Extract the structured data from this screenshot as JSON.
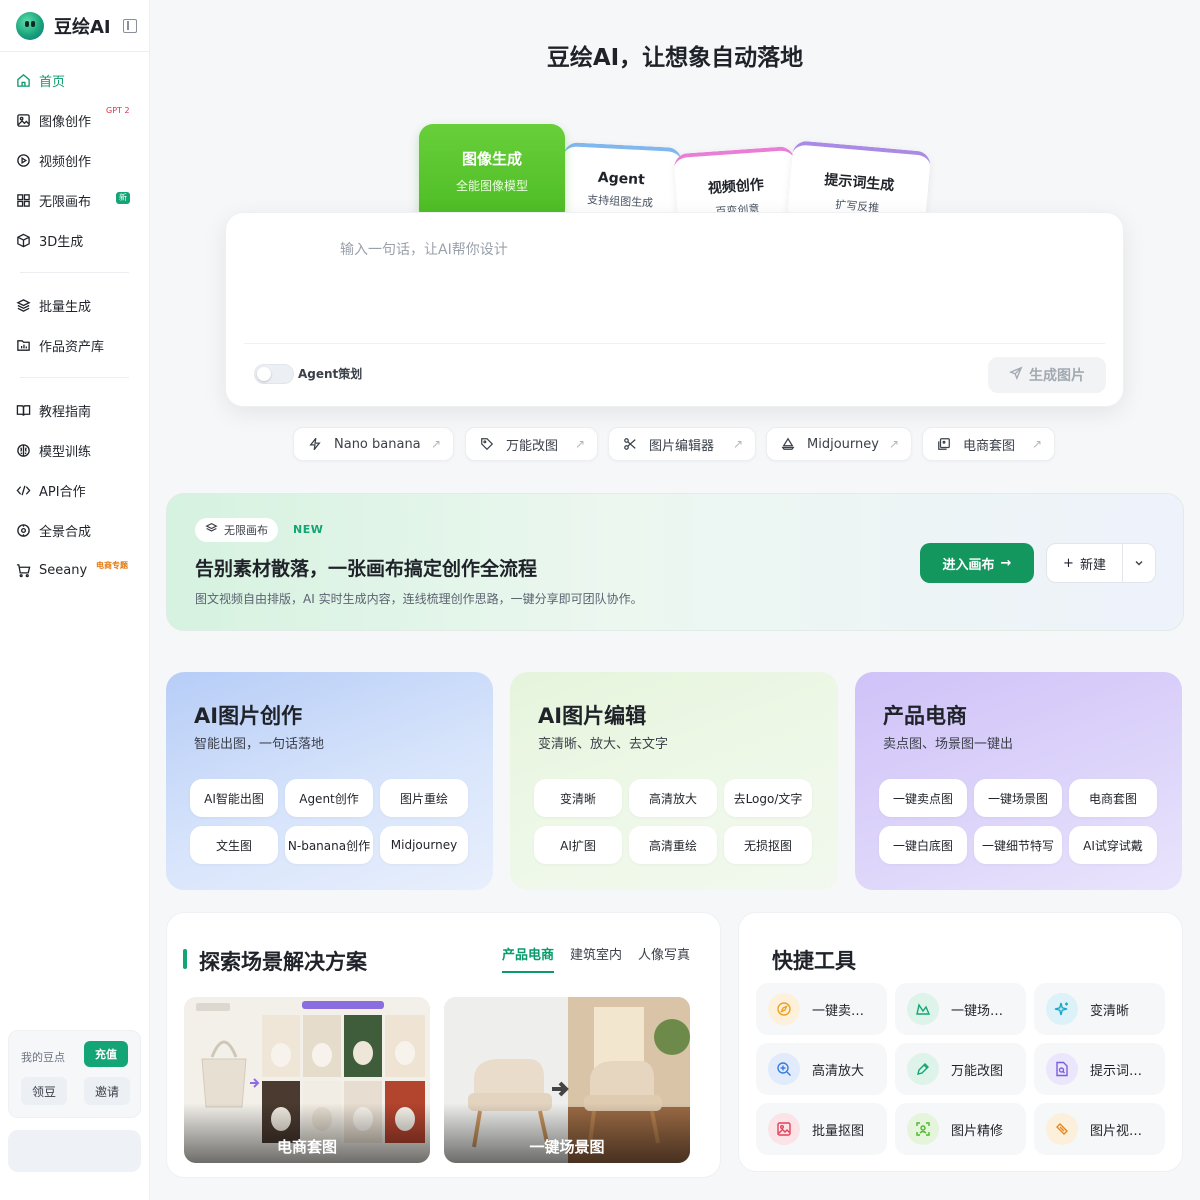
{
  "app": {
    "name": "豆绘AI"
  },
  "sidebar": {
    "items": [
      {
        "label": "首页"
      },
      {
        "label": "图像创作",
        "badge": "GPT 2"
      },
      {
        "label": "视频创作"
      },
      {
        "label": "无限画布",
        "badge": "新"
      },
      {
        "label": "3D生成"
      },
      {
        "label": "批量生成"
      },
      {
        "label": "作品资产库"
      },
      {
        "label": "教程指南"
      },
      {
        "label": "模型训练"
      },
      {
        "label": "API合作"
      },
      {
        "label": "全景合成"
      },
      {
        "label": "Seeany",
        "badge": "电商专题"
      }
    ],
    "points_label": "我的豆点",
    "recharge": "充值",
    "claim": "领豆",
    "invite": "邀请"
  },
  "headline": "豆绘AI，让想象自动落地",
  "mode_tabs": [
    {
      "title": "图像生成",
      "subtitle": "全能图像模型"
    },
    {
      "title": "Agent",
      "subtitle": "支持组图生成"
    },
    {
      "title": "视频创作",
      "subtitle": "百变创意"
    },
    {
      "title": "提示词生成",
      "subtitle": "扩写反推"
    }
  ],
  "prompt": {
    "placeholder": "输入一句话，让AI帮你设计",
    "agent_toggle": "Agent策划",
    "generate": "生成图片"
  },
  "quick_chips": [
    {
      "label": "Nano banana"
    },
    {
      "label": "万能改图"
    },
    {
      "label": "图片编辑器"
    },
    {
      "label": "Midjourney"
    },
    {
      "label": "电商套图"
    }
  ],
  "banner": {
    "pill": "无限画布",
    "new_tag": "NEW",
    "title": "告别素材散落，一张画布搞定创作全流程",
    "desc": "图文视频自由排版，AI 实时生成内容，连线梳理创作思路，一键分享即可团队协作。",
    "enter": "进入画布",
    "new": "新建"
  },
  "categories": [
    {
      "title": "AI图片创作",
      "subtitle": "智能出图，一句话落地",
      "buttons": [
        "AI智能出图",
        "Agent创作",
        "图片重绘",
        "文生图",
        "N-banana创作",
        "Midjourney"
      ]
    },
    {
      "title": "AI图片编辑",
      "subtitle": "变清晰、放大、去文字",
      "buttons": [
        "变清晰",
        "高清放大",
        "去Logo/文字",
        "AI扩图",
        "高清重绘",
        "无损抠图"
      ]
    },
    {
      "title": "产品电商",
      "subtitle": "卖点图、场景图一键出",
      "buttons": [
        "一键卖点图",
        "一键场景图",
        "电商套图",
        "一键白底图",
        "一键细节特写",
        "AI试穿试戴"
      ]
    }
  ],
  "scenes": {
    "title": "探索场景解决方案",
    "tabs": [
      "产品电商",
      "建筑室内",
      "人像写真"
    ],
    "cards": [
      {
        "caption": "电商套图"
      },
      {
        "caption": "一键场景图"
      }
    ]
  },
  "tools": {
    "title": "快捷工具",
    "items": [
      {
        "label": "一键卖…",
        "icon": "compass-icon",
        "color": "#f0a020",
        "bg": "#fdf1dc"
      },
      {
        "label": "一键场…",
        "icon": "mountain-icon",
        "color": "#13a575",
        "bg": "#def3ea"
      },
      {
        "label": "变清晰",
        "icon": "sparkle-icon",
        "color": "#1aa7c9",
        "bg": "#dcf2f8"
      },
      {
        "label": "高清放大",
        "icon": "zoom-in-icon",
        "color": "#3a7be0",
        "bg": "#e1ebfb"
      },
      {
        "label": "万能改图",
        "icon": "pen-icon",
        "color": "#13a575",
        "bg": "#def3ea"
      },
      {
        "label": "提示词…",
        "icon": "file-search-icon",
        "color": "#7a5ee0",
        "bg": "#ebe6fb"
      },
      {
        "label": "批量抠图",
        "icon": "image-icon",
        "color": "#e0445a",
        "bg": "#fbe3e7"
      },
      {
        "label": "图片精修",
        "icon": "scan-face-icon",
        "color": "#4cb82a",
        "bg": "#e4f5dc"
      },
      {
        "label": "图片视…",
        "icon": "ticket-icon",
        "color": "#e08a20",
        "bg": "#fcefdc"
      }
    ]
  }
}
